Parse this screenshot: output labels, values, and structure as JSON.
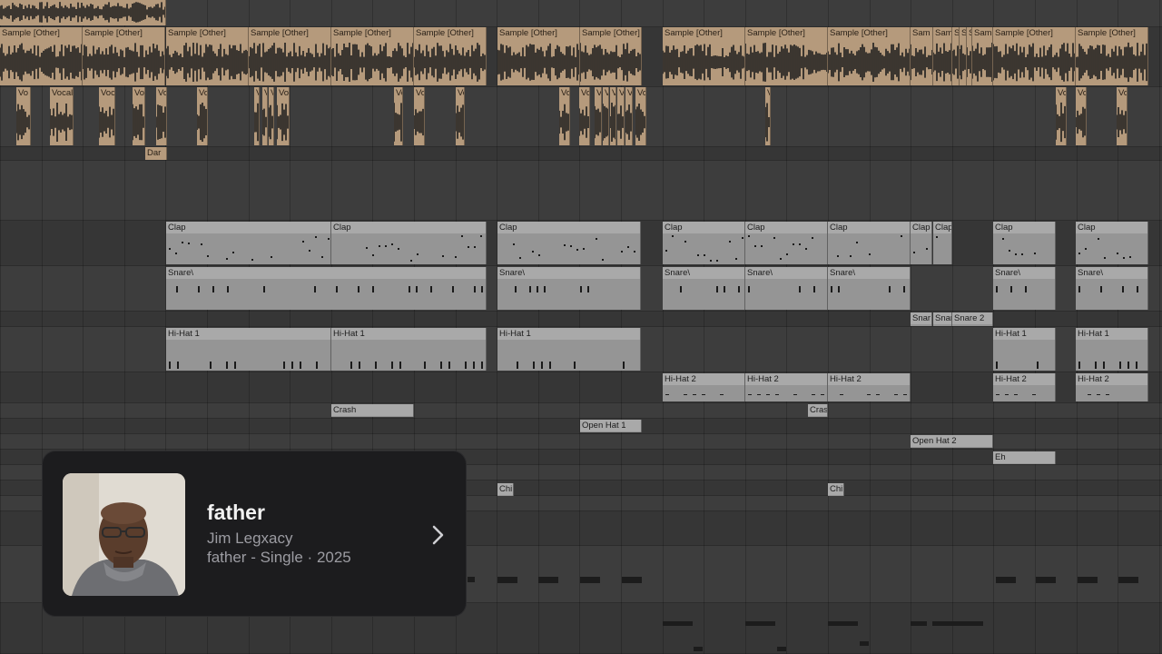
{
  "now_playing": {
    "title": "father",
    "artist": "Jim Legxacy",
    "subtitle": "father - Single · 2025",
    "icons": {
      "next": "chevron-right-icon",
      "artwork": "album-artwork"
    }
  },
  "clips": {
    "sample": "Sample [Other]",
    "sample_short": "Sam",
    "sample_s": "S",
    "vocal": "Vocal",
    "voc": "Voc",
    "vo": "Vo",
    "v": "V",
    "dar": "Dar",
    "clap": "Clap",
    "snare": "Snare\\",
    "snare2": "Snare 2",
    "snar": "Snar",
    "hihat1": "Hi-Hat 1",
    "hihat2": "Hi-Hat 2",
    "crash": "Crash",
    "cras": "Cras",
    "openhat1": "Open Hat 1",
    "openhat2": "Open Hat 2",
    "eh": "Eh",
    "chi": "Chi"
  },
  "colors": {
    "audio_clip": "#b59a7c",
    "midi_clip": "#959595",
    "card_bg": "#1c1c1e",
    "card_title": "#f2f2f2",
    "card_secondary": "#9c9ca2"
  }
}
